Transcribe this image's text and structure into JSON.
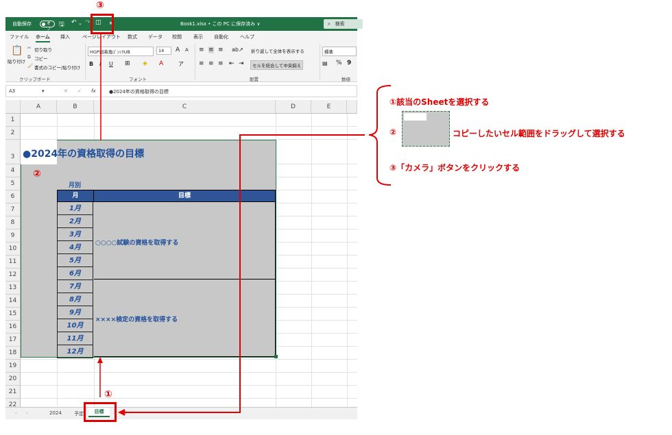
{
  "titlebar": {
    "autosave_label": "自動保存",
    "autosave_state": "オフ",
    "file_title": "Book1.xlsx • この PC に保存済み ∨",
    "search_placeholder": "検索"
  },
  "menu": [
    "ファイル",
    "ホーム",
    "挿入",
    "ページレイアウト",
    "数式",
    "データ",
    "校閲",
    "表示",
    "自動化",
    "ヘルプ"
  ],
  "ribbon": {
    "paste": "貼り付け",
    "cut": "切り取り",
    "copy": "コピー",
    "format_painter": "書式のコピー/貼り付け",
    "clipboard_group": "クリップボード",
    "font_name": "HGP創英角ｺﾞｼｯｸUB",
    "font_size": "14",
    "font_grow": "A",
    "font_shrink": "A",
    "bold": "B",
    "italic": "I",
    "underline": "U",
    "font_group": "フォント",
    "wrap_text": "折り返して全体を表示する",
    "merge_center": "セルを結合して中央揃え",
    "alignment_group": "配置",
    "number_format": "標準",
    "percent": "%",
    "comma": "9",
    "number_group": "数値"
  },
  "formula_bar": {
    "name_box": "A3",
    "fx": "fx",
    "value": "●2024年の資格取得の目標"
  },
  "columns": [
    "A",
    "B",
    "C",
    "D",
    "E"
  ],
  "rows": [
    "1",
    "2",
    "3",
    "4",
    "5",
    "6",
    "7",
    "8",
    "9",
    "10",
    "11",
    "12",
    "13",
    "14",
    "15",
    "16",
    "17",
    "18",
    "19",
    "20",
    "21",
    "22"
  ],
  "sheet": {
    "title": "●2024年の資格取得の目標",
    "monthly_label": "月別",
    "header_month": "月",
    "header_goal": "目標",
    "months": [
      "1月",
      "2月",
      "3月",
      "4月",
      "5月",
      "6月",
      "7月",
      "8月",
      "9月",
      "10月",
      "11月",
      "12月"
    ],
    "goal1": "○○○○試験の資格を取得する",
    "goal2": "××××検定の資格を取得する"
  },
  "tabs": {
    "sheet1": "2024",
    "sheet2": "予定",
    "sheet3": "目標",
    "add": "+"
  },
  "annotations": {
    "mark1": "①",
    "mark2": "②",
    "mark3": "③",
    "step1": "①該当のSheetを選択する",
    "step2_mark": "②",
    "step2": "コピーしたいセル範囲をドラッグして選択する",
    "step3": "③「カメラ」ボタンをクリックする"
  },
  "colors": {
    "excel_green": "#217346",
    "header_blue": "#2f5597",
    "text_blue": "#1f4e9a",
    "annotation_red": "#e00000",
    "selection_gray": "#c8c8c8"
  }
}
